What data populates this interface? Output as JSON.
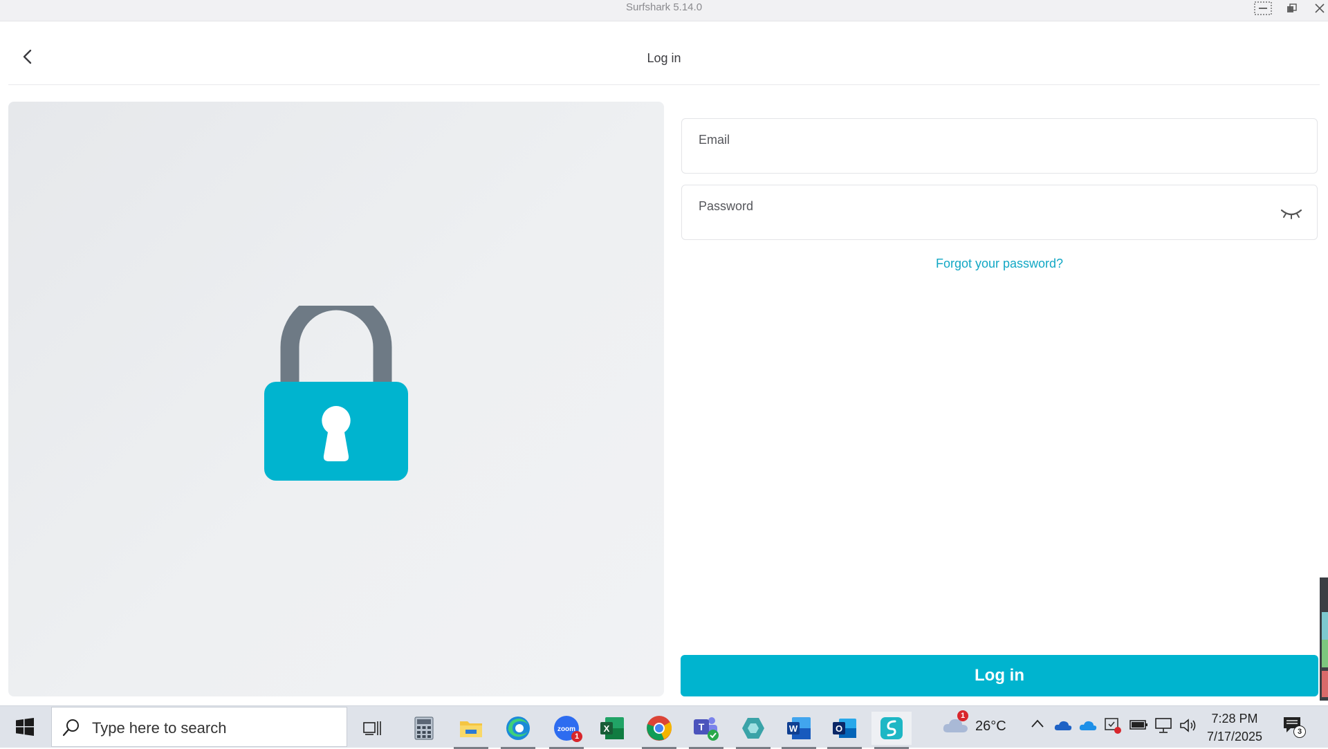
{
  "window": {
    "title": "Surfshark 5.14.0"
  },
  "header": {
    "title": "Log in"
  },
  "form": {
    "email_label": "Email",
    "email_value": "",
    "password_label": "Password",
    "password_value": "",
    "forgot_link": "Forgot your password?",
    "submit_label": "Log in"
  },
  "colors": {
    "accent": "#00b4cf",
    "link": "#11a7c4",
    "lock_shackle": "#6e7a85",
    "lock_body": "#00b4cf"
  },
  "taskbar": {
    "search_placeholder": "Type here to search",
    "apps": [
      {
        "name": "task-view-icon"
      },
      {
        "name": "calculator-icon"
      },
      {
        "name": "file-explorer-icon"
      },
      {
        "name": "edge-icon"
      },
      {
        "name": "zoom-icon",
        "badge": "1"
      },
      {
        "name": "excel-icon"
      },
      {
        "name": "chrome-icon"
      },
      {
        "name": "teams-icon"
      },
      {
        "name": "app-diamond-icon"
      },
      {
        "name": "word-icon"
      },
      {
        "name": "outlook-icon"
      },
      {
        "name": "surfshark-icon"
      }
    ],
    "weather": {
      "temperature": "26°C",
      "badge": "1"
    },
    "clock": {
      "time": "7:28 PM",
      "date": "7/17/2025"
    },
    "notifications": {
      "count": "3"
    }
  }
}
